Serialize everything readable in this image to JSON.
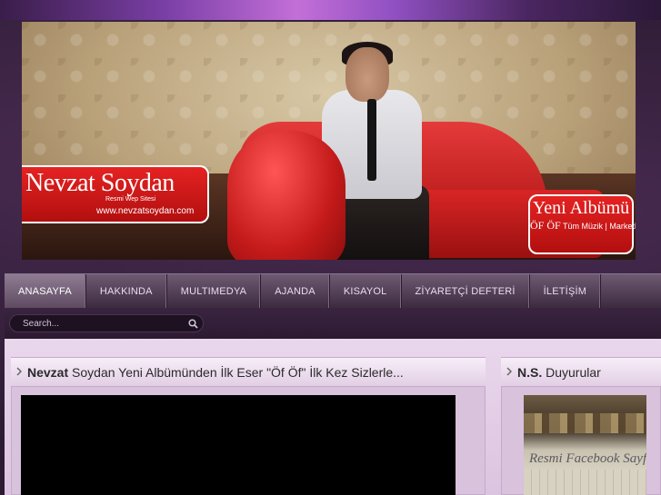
{
  "banner": {
    "logo_title": "Nevzat Soydan",
    "logo_subtitle": "Resmi Wep Sitesi",
    "logo_url": "www.nevzatsoydan.com",
    "album_title": "Yeni Albümü",
    "album_name": "ÖF ÖF",
    "album_note": "Tüm Müzik | Marketlerde"
  },
  "nav": {
    "items": [
      {
        "label": "ANASAYFA",
        "active": true
      },
      {
        "label": "HAKKINDA",
        "active": false
      },
      {
        "label": "MULTIMEDYA",
        "active": false
      },
      {
        "label": "AJANDA",
        "active": false
      },
      {
        "label": "KISAYOL",
        "active": false
      },
      {
        "label": "ZİYARETÇİ DEFTERİ",
        "active": false
      },
      {
        "label": "İLETİŞİM",
        "active": false
      }
    ]
  },
  "search": {
    "placeholder": "Search..."
  },
  "main": {
    "title_bold": "Nevzat",
    "title_rest": " Soydan Yeni Albümünden İlk Eser \"Öf Öf\" İlk Kez Sizlerle..."
  },
  "side": {
    "title_bold": "N.S.",
    "title_rest": " Duyurular",
    "image_caption": "Resmi Facebook Sayfa"
  },
  "colors": {
    "accent_red": "#d81b1b",
    "nav_bg": "#5a4760",
    "content_bg": "#e4cfe7"
  },
  "icons": {
    "search": "search-icon",
    "chevron": "chevron-right-icon"
  }
}
